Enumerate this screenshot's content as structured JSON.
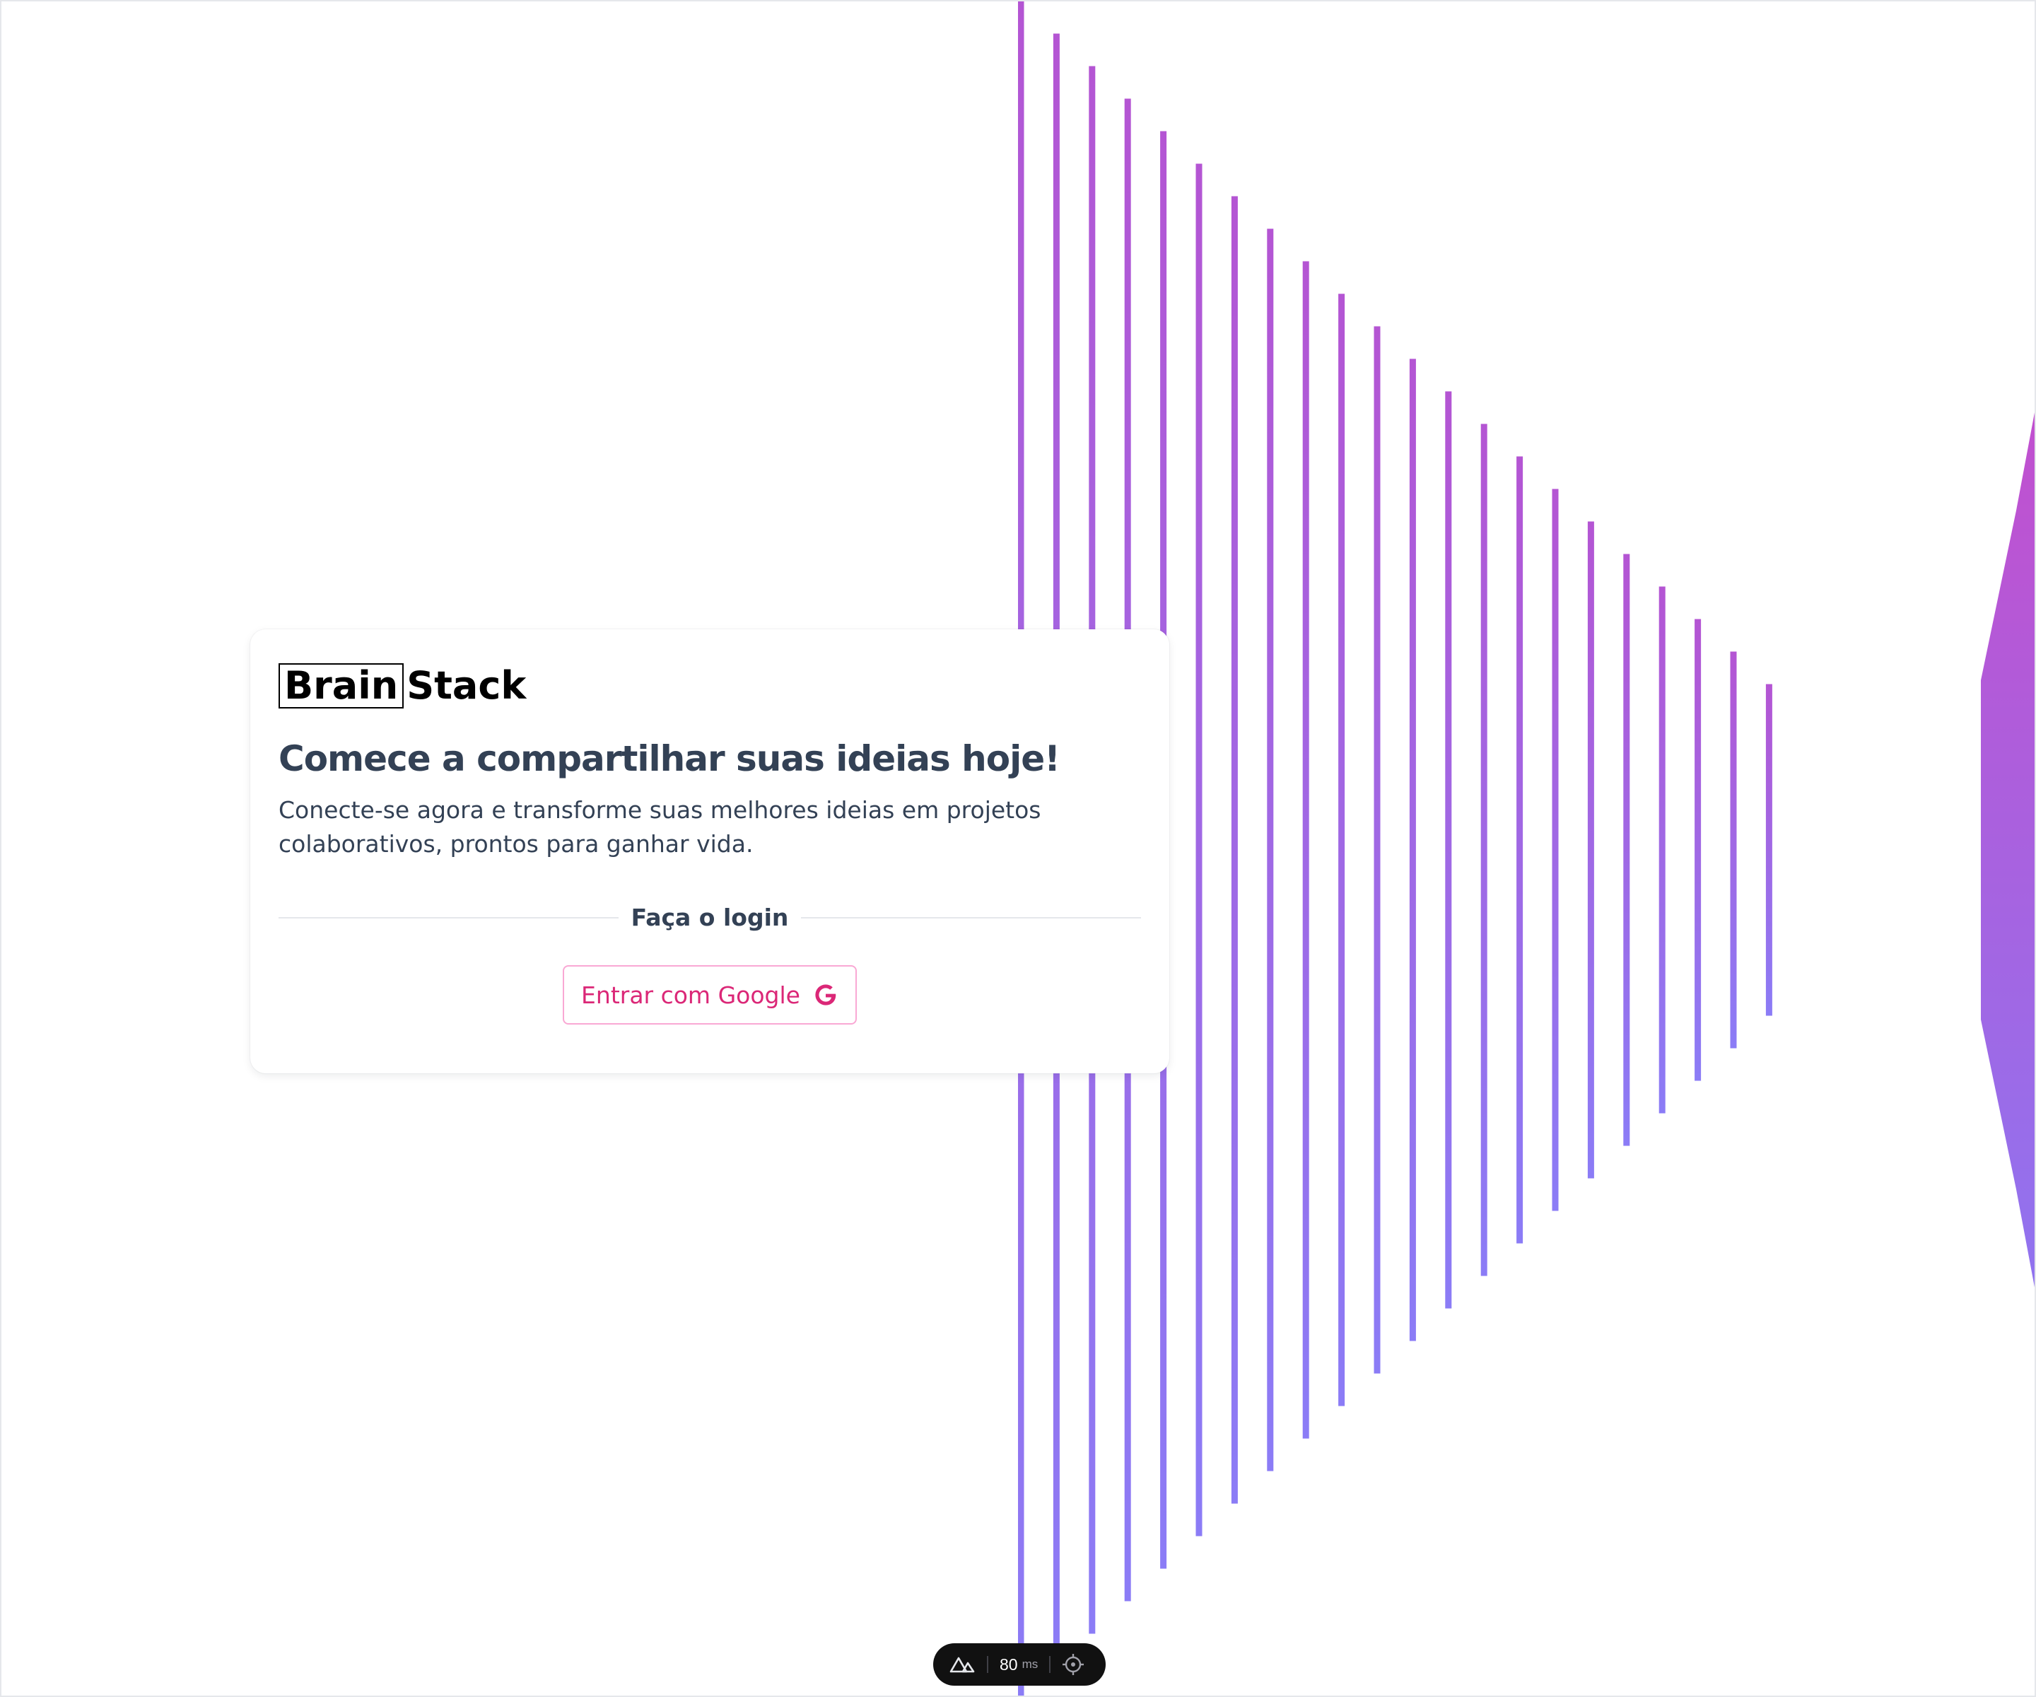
{
  "logo": {
    "part1": "Brain",
    "part2": "Stack"
  },
  "card": {
    "title": "Comece a compartilhar suas ideias hoje!",
    "description": "Conecte-se agora e transforme suas melhores ideias em projetos colaborativos, prontos para ganhar vida.",
    "divider_label": "Faça o login",
    "google_button_label": "Entrar com Google"
  },
  "devtools": {
    "value": "80",
    "unit": "ms"
  },
  "colors": {
    "gradient_pink": "#e91e9c",
    "gradient_purple": "#b455d3",
    "gradient_blue": "#8b7cf6",
    "accent": "#db2777",
    "text_dark": "#334155"
  },
  "icons": [
    "google-icon",
    "nuxt-logo-icon",
    "crosshair-icon"
  ]
}
